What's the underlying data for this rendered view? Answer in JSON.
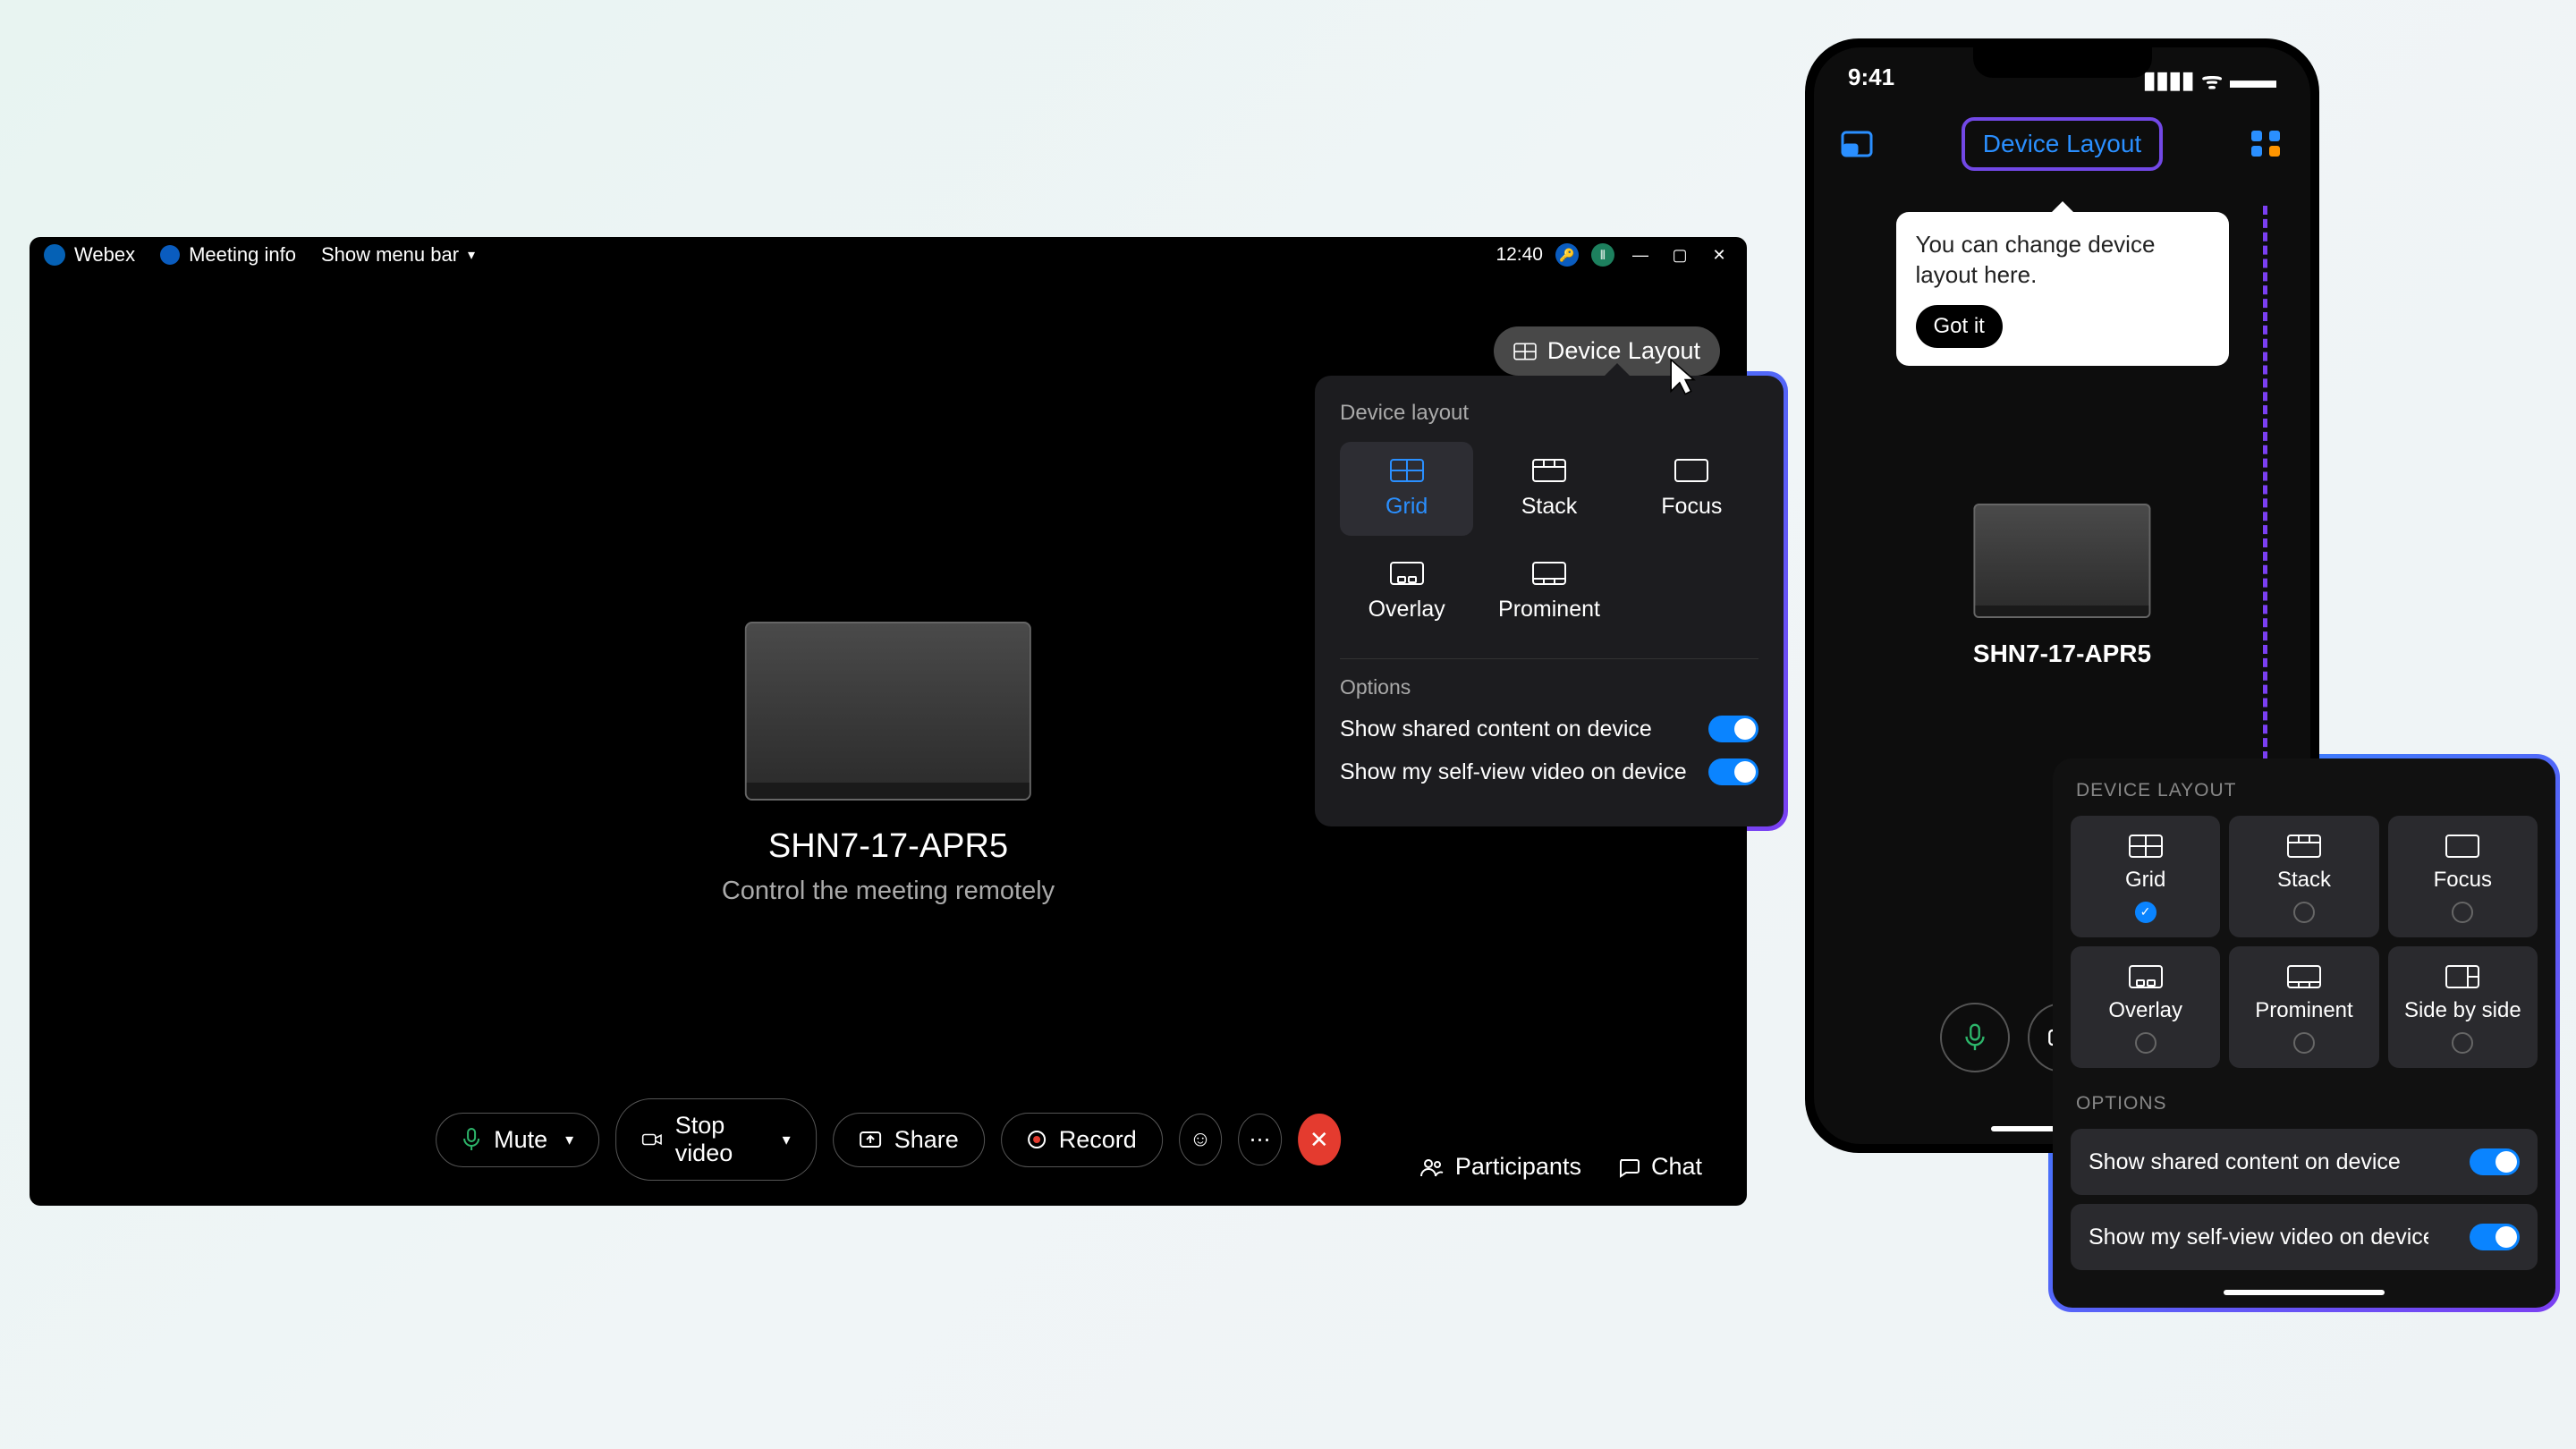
{
  "desktop": {
    "titlebar": {
      "app_name": "Webex",
      "meeting_info": "Meeting info",
      "show_menu": "Show menu bar",
      "clock": "12:40"
    },
    "layout_button": "Device Layout",
    "device_name": "SHN7-17-APR5",
    "device_sub": "Control the meeting remotely",
    "popover": {
      "title": "Device layout",
      "layouts": [
        "Grid",
        "Stack",
        "Focus",
        "Overlay",
        "Prominent"
      ],
      "options_title": "Options",
      "opt1": "Show shared content on device",
      "opt2": "Show my self-view video on device"
    },
    "controls": {
      "mute": "Mute",
      "stop_video": "Stop video",
      "share": "Share",
      "record": "Record",
      "participants": "Participants",
      "chat": "Chat"
    }
  },
  "phone": {
    "time": "9:41",
    "layout_button": "Device Layout",
    "tooltip_text": "You can change device layout here.",
    "tooltip_btn": "Got it",
    "device_name": "SHN7-17-APR5"
  },
  "mobile_panel": {
    "title": "DEVICE LAYOUT",
    "layouts": [
      "Grid",
      "Stack",
      "Focus",
      "Overlay",
      "Prominent",
      "Side by side"
    ],
    "options_title": "OPTIONS",
    "opt1": "Show shared content on device",
    "opt2": "Show my self-view video on device"
  }
}
